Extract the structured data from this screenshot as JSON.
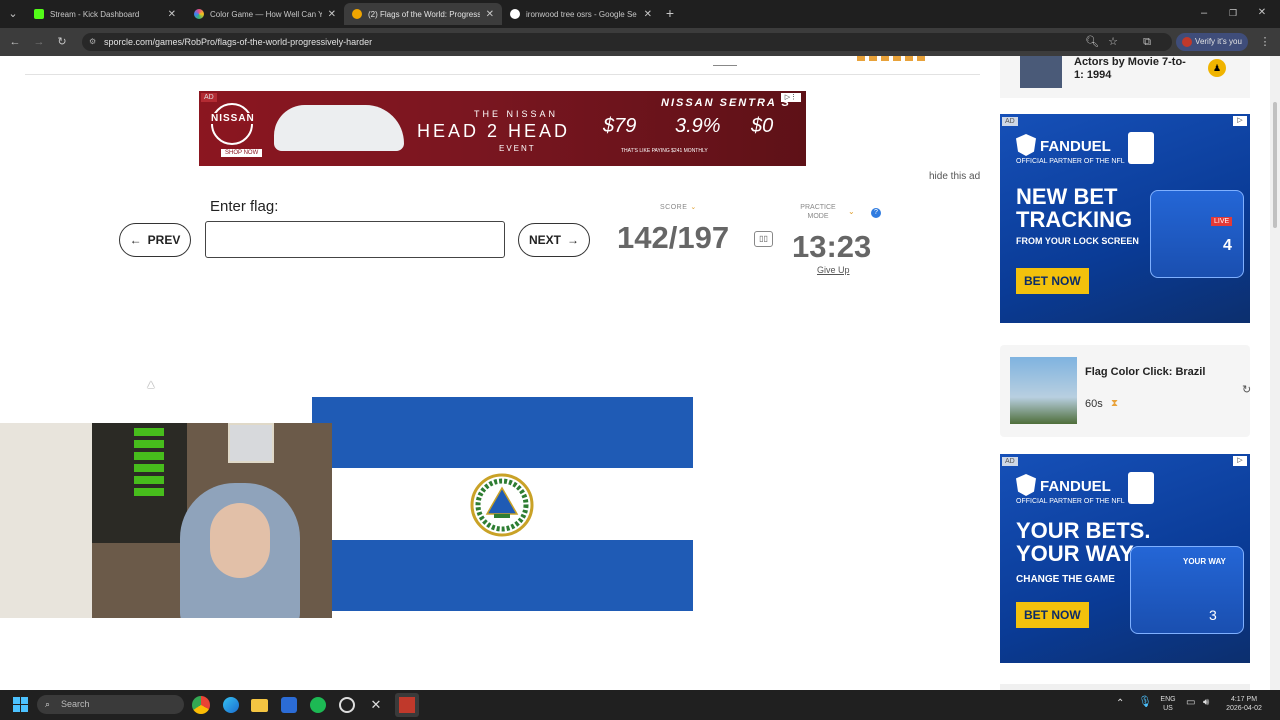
{
  "browser": {
    "tabs": [
      {
        "title": "Stream - Kick Dashboard",
        "fav": "#53fc18"
      },
      {
        "title": "Color Game — How Well Can Y",
        "fav": "#e94b8a"
      },
      {
        "title": "(2) Flags of the World: Progress",
        "fav": "#f0a500"
      },
      {
        "title": "ironwood tree osrs - Google Se",
        "fav": "#ffffff"
      }
    ],
    "new_tab": "+",
    "url": "sporcle.com/games/RobPro/flags-of-the-world-progressively-harder",
    "profile_label": "Verify it's you"
  },
  "ads": {
    "nissan": {
      "tag": "AD",
      "brand": "NISSAN",
      "shop": "SHOP NOW",
      "title_top": "THE NISSAN",
      "title_main": "HEAD 2 HEAD",
      "event": "EVENT",
      "model": "NISSAN SENTRA S",
      "price1": "$79",
      "rate": "3.9%",
      "price2": "$0",
      "fine": "THAT'S LIKE PAYING $241 MONTHLY"
    },
    "hide": "hide this ad",
    "fanduel1": {
      "tag": "AD",
      "brand": "FANDUEL",
      "partner": "OFFICIAL PARTNER OF THE NFL",
      "line1": "NEW BET",
      "line2": "TRACKING",
      "line3": "FROM YOUR LOCK SCREEN",
      "cta": "BET NOW",
      "phone_live": "LIVE",
      "phone_stat": "4"
    },
    "fanduel2": {
      "tag": "AD",
      "brand": "FANDUEL",
      "partner": "OFFICIAL PARTNER OF THE NFL",
      "line1": "YOUR BETS.",
      "line2": "YOUR WAY.",
      "line3": "CHANGE THE GAME",
      "cta": "BET NOW",
      "phone_title": "YOUR WAY",
      "phone_stat": "3"
    }
  },
  "quiz": {
    "prompt": "Enter flag:",
    "prev": "PREV",
    "next": "NEXT",
    "answer_value": "",
    "score_label": "SCORE",
    "score": "142/197",
    "mode_label": "PRACTICE MODE",
    "timer": "13:23",
    "give_up": "Give Up",
    "help": "?"
  },
  "sidebar": {
    "top_card": "Actors by Movie 7-to-1: 1994",
    "flag_card_title": "Flag Color Click: Brazil",
    "flag_card_time": "60s"
  },
  "flag": {
    "blue": "#1f5bb5",
    "white": "#ffffff"
  },
  "taskbar": {
    "search": "Search",
    "lang_top": "ENG",
    "lang_bottom": "US",
    "time": "4:17 PM",
    "date": "2026-04-02"
  }
}
